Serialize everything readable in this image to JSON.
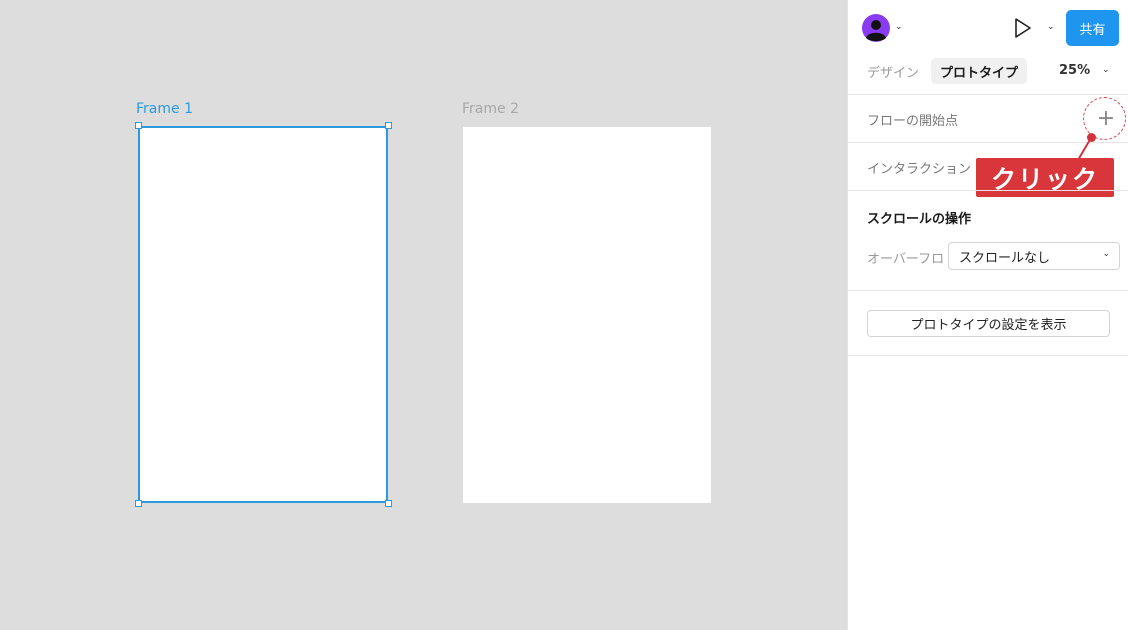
{
  "canvas": {
    "frames": [
      {
        "label": "Frame 1",
        "selected": true
      },
      {
        "label": "Frame 2",
        "selected": false
      }
    ]
  },
  "header": {
    "share_label": "共有",
    "avatar_icon": "user-avatar-icon",
    "play_icon": "play-icon"
  },
  "tabs": [
    {
      "label": "デザイン",
      "active": false
    },
    {
      "label": "プロトタイプ",
      "active": true
    }
  ],
  "zoom": {
    "value": "25%"
  },
  "flow": {
    "label": "フローの開始点",
    "add_icon": "plus-icon"
  },
  "interaction": {
    "label": "インタラクション"
  },
  "callout": {
    "text": "クリック"
  },
  "scroll": {
    "title": "スクロールの操作",
    "overflow_label": "オーバーフロ",
    "overflow_value": "スクロールなし"
  },
  "prototype_settings": {
    "label": "プロトタイプの設定を表示"
  },
  "colors": {
    "accent": "#1e96ef",
    "selection": "#2d9ae0",
    "callout": "#d9363c"
  }
}
